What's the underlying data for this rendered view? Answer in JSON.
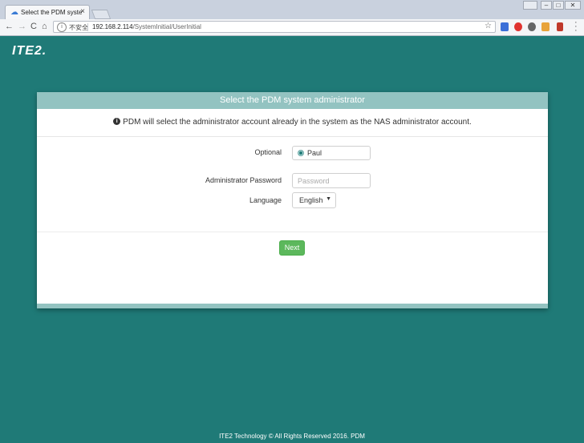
{
  "browser": {
    "tab_title": "Select the PDM system",
    "tab_close": "×",
    "nav_back": "←",
    "nav_forward": "→",
    "nav_reload": "C",
    "nav_home": "⌂",
    "insecure_label": "不安全",
    "url_host": "192.168.2.114",
    "url_path": "/SystemInitial/UserInitial",
    "bookmark_star": "☆"
  },
  "page": {
    "logo_text": "ITE2.",
    "card_title": "Select the PDM system administrator",
    "notice_icon": "i",
    "notice_text": "PDM will select the administrator account already in the system as the NAS administrator account.",
    "optional_label": "Optional",
    "radio_value": "Paul",
    "password_label": "Administrator Password",
    "password_placeholder": "Password",
    "language_label": "Language",
    "language_value": "English",
    "next_label": "Next",
    "footer_text": "ITE2 Technology © All Rights Reserved 2016. PDM"
  },
  "colors": {
    "background": "#1f7a77",
    "card_header": "#93c3c1",
    "next_button": "#5cb85c"
  }
}
